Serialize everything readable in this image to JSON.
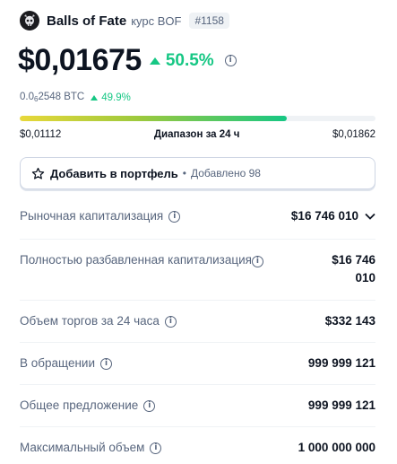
{
  "header": {
    "name": "Balls of Fate",
    "subtitle": "курс BOF",
    "rank": "#1158",
    "logo_icon": "skull-logo-icon"
  },
  "price": {
    "value": "$0,01675",
    "change": "50.5%",
    "direction": "up",
    "btc_prefix": "0.0",
    "btc_sub": "6",
    "btc_rest": "2548 BTC",
    "btc_change": "49.9%"
  },
  "range": {
    "low": "$0,01112",
    "label": "Диапазон за 24 ч",
    "high": "$0,01862",
    "position_fraction": 0.75
  },
  "portfolio": {
    "label": "Добавить в портфель",
    "added": "Добавлено 98"
  },
  "stats": [
    {
      "label": "Рыночная капитализация",
      "value": "$16 746 010",
      "has_chevron": true
    },
    {
      "label": "Полностью разбавленная капитализация",
      "value": "$16 746 010",
      "two_line": true
    },
    {
      "label": "Объем торгов за 24 часа",
      "value": "$332 143"
    },
    {
      "label": "В обращении",
      "value": "999 999 121"
    },
    {
      "label": "Общее предложение",
      "value": "999 999 121"
    },
    {
      "label": "Максимальный объем",
      "value": "1 000 000 000"
    }
  ],
  "colors": {
    "positive": "#16c784",
    "text_primary": "#0d1421",
    "text_secondary": "#58667e",
    "divider": "#eff2f5"
  }
}
